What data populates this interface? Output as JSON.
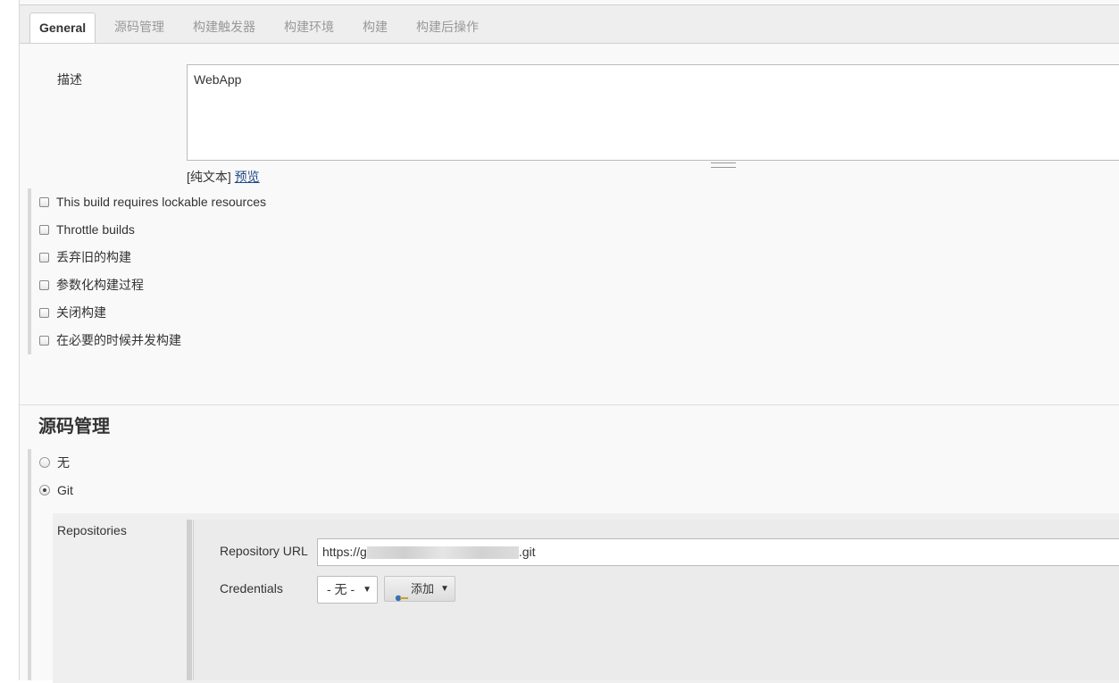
{
  "tabs": [
    "General",
    "源码管理",
    "构建触发器",
    "构建环境",
    "构建",
    "构建后操作"
  ],
  "general": {
    "description_label": "描述",
    "description_value": "WebApp",
    "plain_text": "[纯文本]",
    "preview": "预览",
    "options": [
      "This build requires lockable resources",
      "Throttle builds",
      "丢弃旧的构建",
      "参数化构建过程",
      "关闭构建",
      "在必要的时候并发构建"
    ]
  },
  "scm": {
    "title": "源码管理",
    "none_label": "无",
    "git_label": "Git",
    "selected": "Git",
    "repositories_label": "Repositories",
    "repo_url_label": "Repository URL",
    "repo_url_prefix": "https://g",
    "repo_url_suffix": ".git",
    "credentials_label": "Credentials",
    "credentials_value": "- 无 -",
    "add_button": "添加"
  }
}
